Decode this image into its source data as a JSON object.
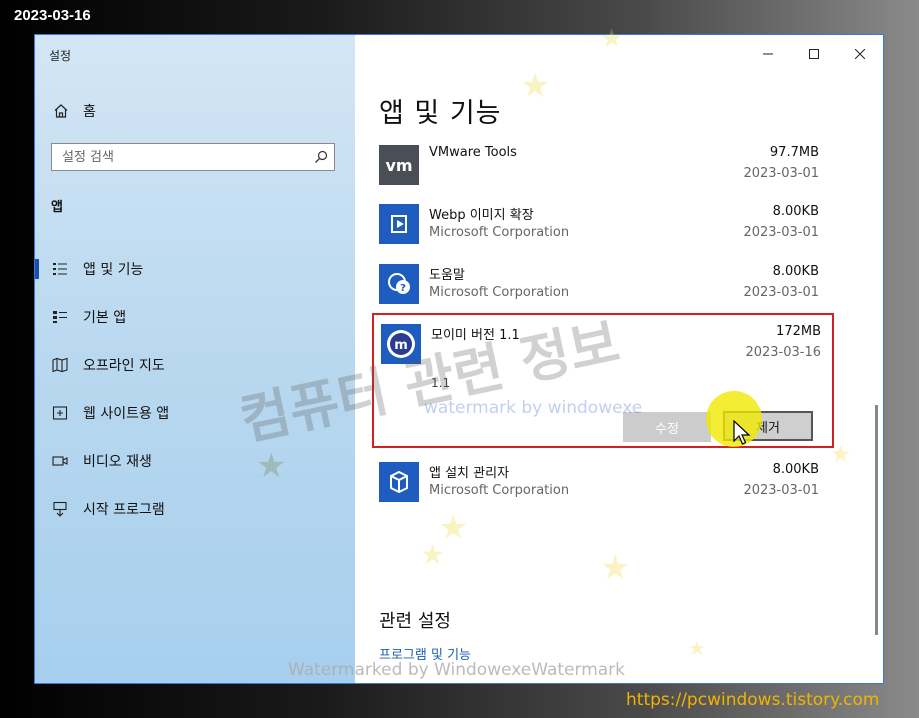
{
  "stamp_date": "2023-03-16",
  "window": {
    "title": "설정"
  },
  "sidebar": {
    "home_label": "홈",
    "search_placeholder": "설정 검색",
    "section_label": "앱",
    "items": [
      {
        "label": "앱 및 기능",
        "icon": "apps-features-icon",
        "active": true
      },
      {
        "label": "기본 앱",
        "icon": "default-apps-icon"
      },
      {
        "label": "오프라인 지도",
        "icon": "offline-maps-icon"
      },
      {
        "label": "웹 사이트용 앱",
        "icon": "apps-for-websites-icon"
      },
      {
        "label": "비디오 재생",
        "icon": "video-playback-icon"
      },
      {
        "label": "시작 프로그램",
        "icon": "startup-icon"
      }
    ]
  },
  "content": {
    "title": "앱 및 기능",
    "apps": [
      {
        "name": "VMware Tools",
        "publisher": "",
        "size": "97.7MB",
        "date": "2023-03-01",
        "icon": "vmware-icon"
      },
      {
        "name": "Webp 이미지 확장",
        "publisher": "Microsoft Corporation",
        "size": "8.00KB",
        "date": "2023-03-01",
        "icon": "webp-extension-icon"
      },
      {
        "name": "도움말",
        "publisher": "Microsoft Corporation",
        "size": "8.00KB",
        "date": "2023-03-01",
        "icon": "help-icon"
      },
      {
        "name": "모이미 버전 1.1",
        "publisher": "",
        "size": "172MB",
        "date": "2023-03-16",
        "version": "1.1",
        "icon": "moimi-icon",
        "expanded": true
      },
      {
        "name": "앱 설치 관리자",
        "publisher": "Microsoft Corporation",
        "size": "8.00KB",
        "date": "2023-03-01",
        "icon": "app-installer-icon"
      }
    ],
    "modify_label": "수정",
    "remove_label": "제거",
    "related_title": "관련 설정",
    "related_link": "프로그램 및 기능"
  },
  "watermarks": {
    "korean": "컴퓨터 관련 정보",
    "center": "watermark by windowexe",
    "bottom": "Watermarked by WindowexeWatermark",
    "site": "https://pcwindows.tistory.com"
  },
  "colors": {
    "accent": "#1c4fa8",
    "highlight_border": "#d32020",
    "link": "#1a5fb4",
    "site_url": "#f0b400"
  }
}
